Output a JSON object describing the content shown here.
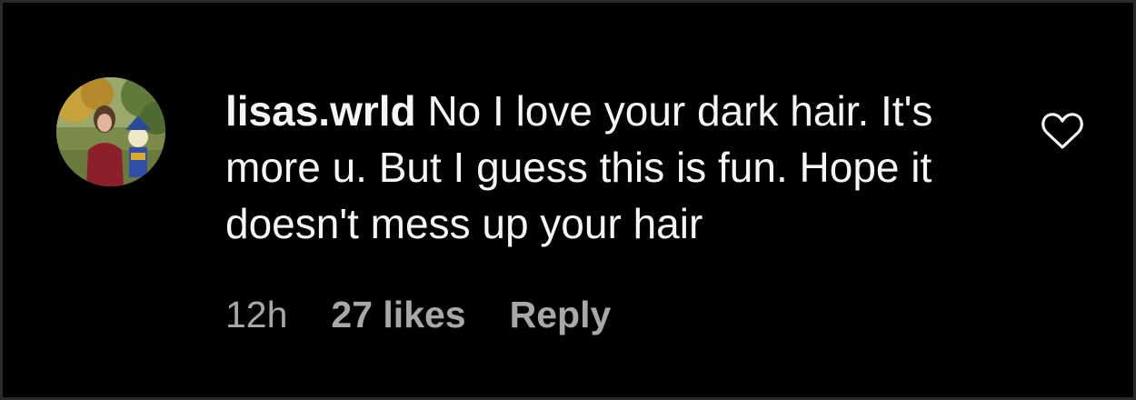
{
  "comment": {
    "avatar_icon": "user-avatar-photo",
    "username": "lisas.wrld",
    "text": "No I love your dark hair. It's more u. But I guess this is fun. Hope it doesn't mess up your hair",
    "like_icon": "heart-outline-icon"
  },
  "meta": {
    "time": "12h",
    "likes": "27 likes",
    "reply_label": "Reply"
  },
  "colors": {
    "background": "#000000",
    "text": "#f5f5f5",
    "secondary_text": "#a8a8a8"
  }
}
